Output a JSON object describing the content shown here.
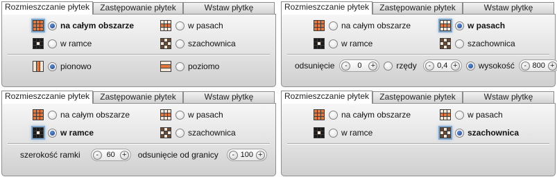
{
  "colors": {
    "tile_orange": "#e2783c",
    "tile_cream": "#f6e8d8",
    "tile_brown": "#6b4a33",
    "tile_black": "#1a1a1a",
    "radio_blue": "#2b5fb5"
  },
  "tabs": [
    "Rozmieszczanie płytek",
    "Zastępowanie płytek",
    "Wstaw płytkę"
  ],
  "options": {
    "whole_area": "na całym obszarze",
    "stripes": "w pasach",
    "frame": "w ramce",
    "checkerboard": "szachownica",
    "vertical": "pionowo",
    "horizontal": "poziomo"
  },
  "stripes_params": {
    "offset_label": "odsunięcie",
    "offset_value": "0",
    "rows_label": "rzędy",
    "rows_value": "0,4",
    "height_label": "wysokość",
    "height_value": "800"
  },
  "frame_params": {
    "width_label": "szerokość ramki",
    "width_value": "60",
    "border_offset_label": "odsunięcie od granicy",
    "border_offset_value": "100"
  },
  "spin_minus": "-",
  "spin_plus": "+",
  "icons": [
    "tile-full-icon",
    "tile-stripes-icon",
    "tile-frame-icon",
    "tile-checker-icon",
    "tile-vertical-icon",
    "tile-horizontal-icon",
    "spin-minus-icon",
    "spin-plus-icon"
  ]
}
